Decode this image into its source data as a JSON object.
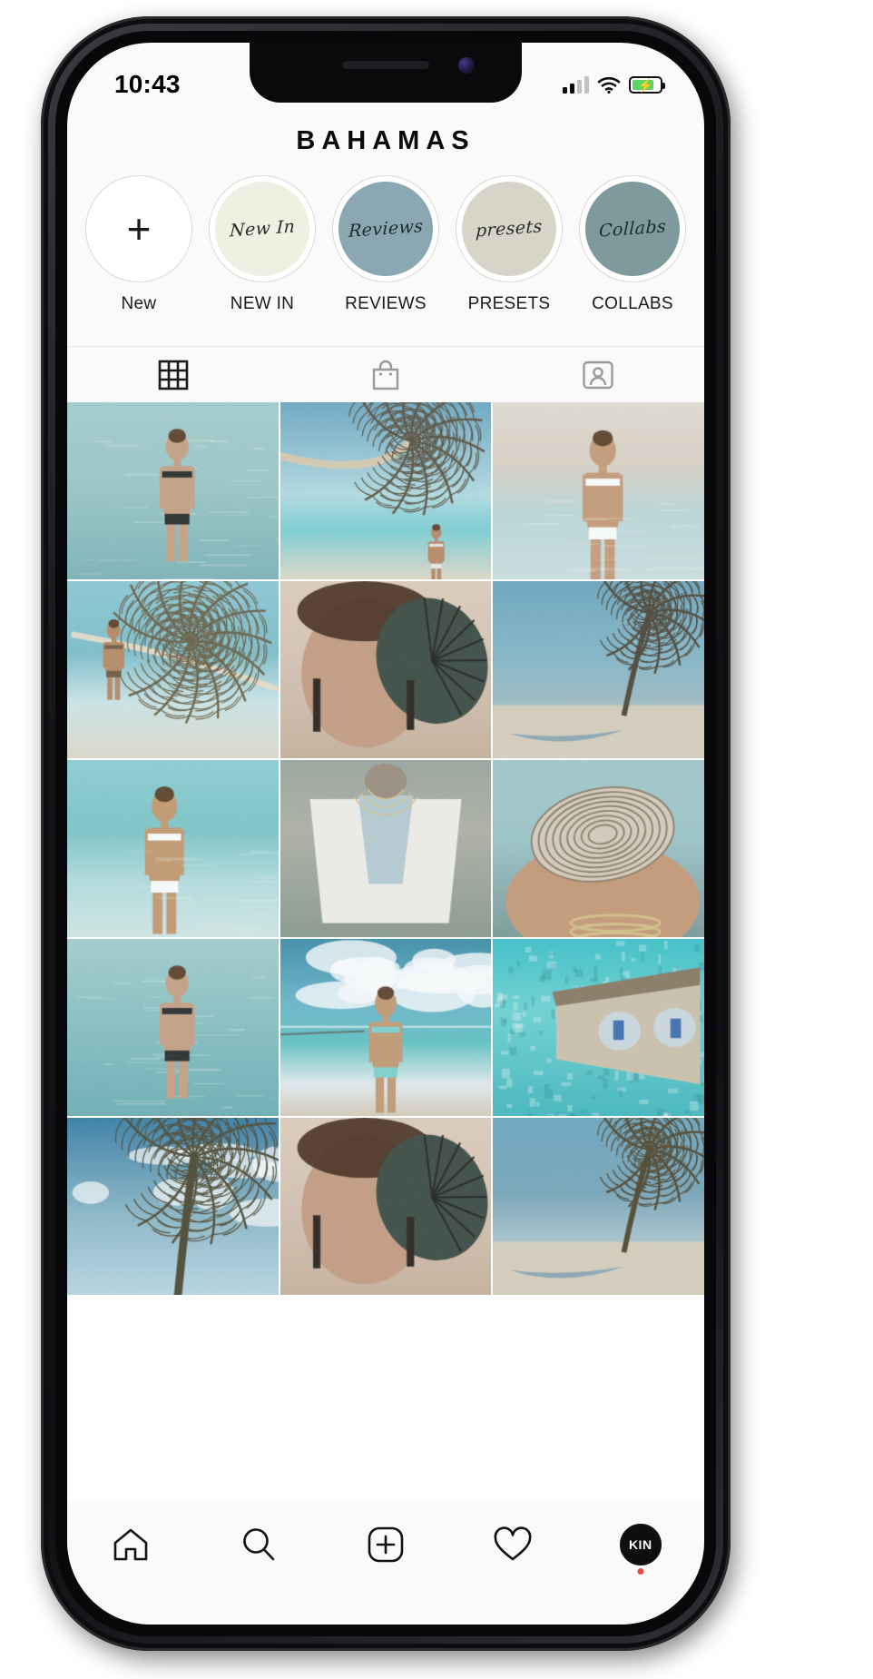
{
  "status_bar": {
    "time": "10:43",
    "signal_icon": "cellular-signal-icon",
    "wifi_icon": "wifi-icon",
    "battery_icon": "battery-charging-icon",
    "battery_level_pct": 78
  },
  "profile": {
    "title": "BAHAMAS"
  },
  "highlights": [
    {
      "label": "New",
      "cover_text": "",
      "bg": "#ffffff",
      "is_add": true,
      "icon": "plus-icon"
    },
    {
      "label": "NEW IN",
      "cover_text": "New In",
      "bg": "#eef0e2",
      "is_add": false,
      "icon": "highlight-cover-new-in"
    },
    {
      "label": "REVIEWS",
      "cover_text": "Reviews",
      "bg": "#8ba7b2",
      "is_add": false,
      "icon": "highlight-cover-reviews"
    },
    {
      "label": "PRESETS",
      "cover_text": "presets",
      "bg": "#d6d5c8",
      "is_add": false,
      "icon": "highlight-cover-presets"
    },
    {
      "label": "COLLABS",
      "cover_text": "Collabs",
      "bg": "#7e9a9c",
      "is_add": false,
      "icon": "highlight-cover-collabs"
    }
  ],
  "tabs": [
    {
      "name": "grid-tab",
      "icon": "grid-icon",
      "active": true
    },
    {
      "name": "shop-tab",
      "icon": "shopping-bag-icon",
      "active": false
    },
    {
      "name": "tagged-tab",
      "icon": "tagged-photos-icon",
      "active": false
    }
  ],
  "grid": {
    "columns": 3,
    "posts": [
      {
        "alt": "woman in turquoise shallow sea from behind",
        "palette": [
          "#9ec9c9",
          "#7fb4b8",
          "#c9a183",
          "#2b2b2b"
        ],
        "scene": "sea_figure"
      },
      {
        "alt": "leaning palm tree over clear lagoon",
        "palette": [
          "#6fa8c4",
          "#bfe4e6",
          "#5c5240",
          "#d8cbb0"
        ],
        "scene": "palm_lagoon"
      },
      {
        "alt": "woman in white swimsuit sitting on wet sand",
        "palette": [
          "#ded3c6",
          "#bfd9da",
          "#c89c78",
          "#ffffff"
        ],
        "scene": "white_suit_sand"
      },
      {
        "alt": "woman sitting on palm trunk at beach",
        "palette": [
          "#7fc0cc",
          "#cfe7e9",
          "#6b6046",
          "#e6ddcb"
        ],
        "scene": "palm_trunk"
      },
      {
        "alt": "portrait of woman holding monstera leaf",
        "palette": [
          "#d9c3b2",
          "#3d4b41",
          "#c79d82",
          "#23231f"
        ],
        "scene": "portrait_leaf"
      },
      {
        "alt": "boat on sand beside windswept palm tree",
        "palette": [
          "#87b7c9",
          "#dcd3c4",
          "#4f4636",
          "#9fbcc4"
        ],
        "scene": "boat_palm"
      },
      {
        "alt": "woman walking in white swimsuit, hair in wind",
        "palette": [
          "#7fc7c8",
          "#b9dfe0",
          "#c6996f",
          "#ffffff"
        ],
        "scene": "white_suit_walk"
      },
      {
        "alt": "woman in blue swimsuit and white cover-up",
        "palette": [
          "#b9ccd3",
          "#f2f0ea",
          "#9c8d7e",
          "#8aa6b4"
        ],
        "scene": "blue_suit_cover"
      },
      {
        "alt": "hand holding a seashell over turquoise water",
        "palette": [
          "#9fc6c8",
          "#d8cdbd",
          "#c79a76",
          "#6e7f7c"
        ],
        "scene": "shell_hand"
      },
      {
        "alt": "woman in bikini wading in shallow sea",
        "palette": [
          "#8cc2c4",
          "#6fb0b4",
          "#c8a184",
          "#2b2b2b"
        ],
        "scene": "sea_figure"
      },
      {
        "alt": "woman running on beach under big clouds",
        "palette": [
          "#3f8fa8",
          "#e7eef0",
          "#d9cdbb",
          "#c49a74"
        ],
        "scene": "beach_run"
      },
      {
        "alt": "aerial of overwater bungalow on turquoise lagoon",
        "palette": [
          "#3fc2c9",
          "#6fd4d4",
          "#8a7a63",
          "#cfc3ad"
        ],
        "scene": "bungalow_aerial"
      },
      {
        "alt": "palm trees against blue sky (partial row)",
        "palette": [
          "#3a7fa8",
          "#bcd9e4",
          "#4f4a33",
          "#8fb9c7"
        ],
        "scene": "palm_sky"
      },
      {
        "alt": "portrait of woman with leaf (partial row)",
        "palette": [
          "#d9c3b2",
          "#3d4b41",
          "#c79d82",
          "#23231f"
        ],
        "scene": "portrait_leaf"
      },
      {
        "alt": "windswept palm tree and sky (partial row)",
        "palette": [
          "#7aa7bb",
          "#cfdfe6",
          "#52472f",
          "#a8c2cb"
        ],
        "scene": "boat_palm"
      }
    ]
  },
  "bottom_nav": [
    {
      "name": "home-nav",
      "icon": "home-icon",
      "label": "Home"
    },
    {
      "name": "search-nav",
      "icon": "search-icon",
      "label": "Search"
    },
    {
      "name": "create-nav",
      "icon": "plus-square-icon",
      "label": "Create"
    },
    {
      "name": "activity-nav",
      "icon": "heart-icon",
      "label": "Activity"
    },
    {
      "name": "profile-nav",
      "icon": "avatar-icon",
      "label": "KIN"
    }
  ]
}
